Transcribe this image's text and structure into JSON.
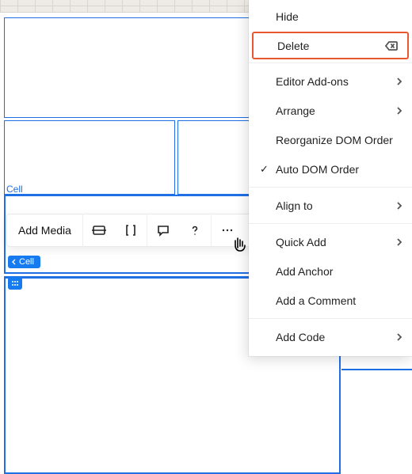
{
  "cell_label": "Cell",
  "toolbar": {
    "add_media": "Add Media"
  },
  "breadcrumb": {
    "cell": "Cell"
  },
  "menu": {
    "hide": "Hide",
    "delete": "Delete",
    "editor_addons": "Editor Add-ons",
    "arrange": "Arrange",
    "reorganize_dom": "Reorganize DOM Order",
    "auto_dom": "Auto DOM Order",
    "align_to": "Align to",
    "quick_add": "Quick Add",
    "add_anchor": "Add Anchor",
    "add_comment": "Add a Comment",
    "add_code": "Add Code"
  }
}
